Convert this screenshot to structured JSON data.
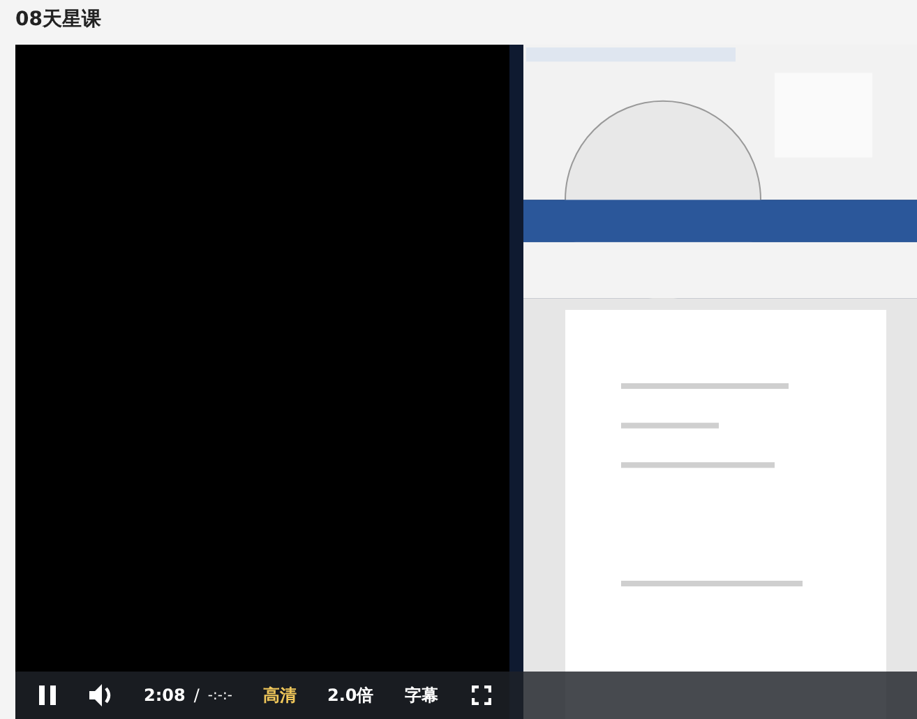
{
  "page": {
    "title": "08天星课"
  },
  "player": {
    "playing": true,
    "time": "2:08",
    "separator": "/",
    "duration": "-:-:-",
    "options": [
      {
        "label": "高清",
        "selected": true
      },
      {
        "label": "2.0倍",
        "selected": false
      },
      {
        "label": "字幕",
        "selected": false
      }
    ]
  }
}
